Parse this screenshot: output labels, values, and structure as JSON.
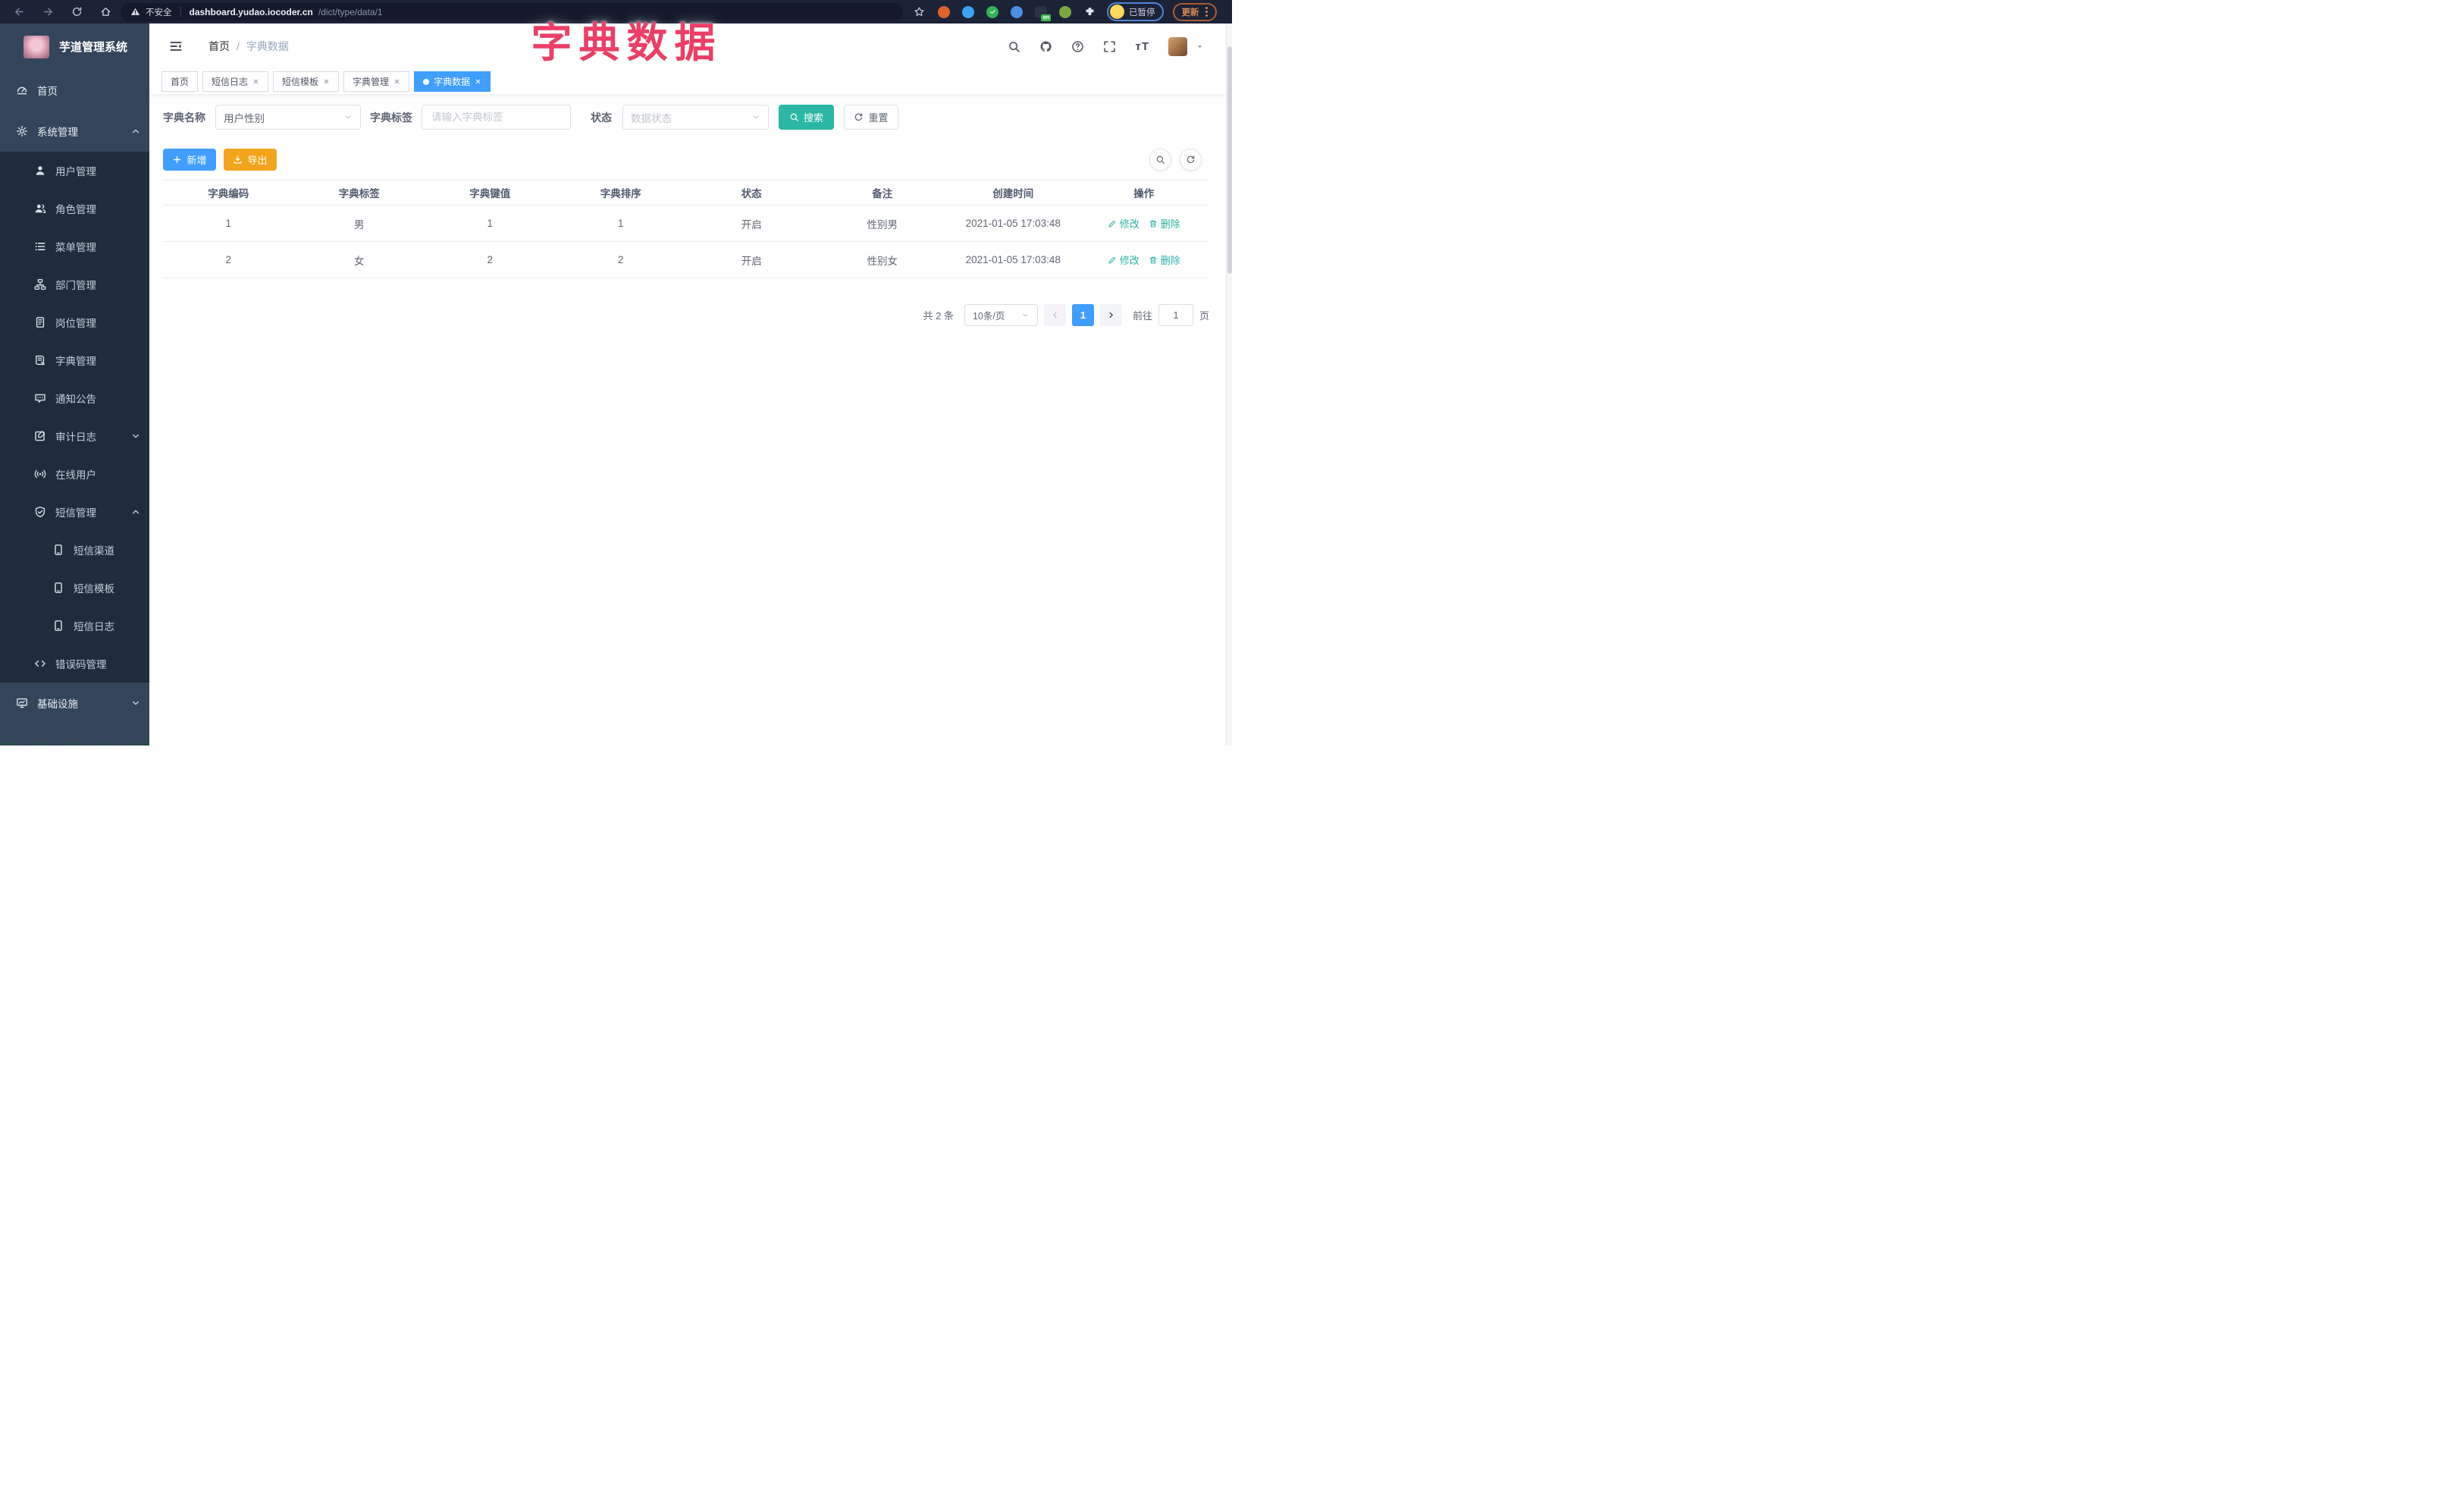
{
  "overlay_title": "字典数据",
  "colors": {
    "primary_blue": "#409eff",
    "search_teal": "#2bb7a5",
    "export_orange": "#f2a41c",
    "overlay_pink": "#ec3e66",
    "sidebar_dark": "#202c3c",
    "sidebar_light": "#34455b",
    "browser_bar": "#1d2337"
  },
  "browser": {
    "security_warning": "不安全",
    "url_host": "dashboard.yudao.iocoder.cn",
    "url_path": "/dict/type/data/1",
    "profile_status": "已暂停",
    "update_label": "更新",
    "extensions": [
      {
        "id": "orange-circle",
        "color": "#e2622b",
        "style": "circle"
      },
      {
        "id": "blue-drop",
        "color": "#3ba3f5",
        "style": "circle"
      },
      {
        "id": "green-check",
        "color": "#2fb457",
        "style": "check"
      },
      {
        "id": "blue-bars",
        "color": "#4b8fe2",
        "style": "circle"
      },
      {
        "id": "dark-on",
        "color": "#2b3242",
        "style": "square",
        "badge": "on",
        "badge_color": "#3dbb4a"
      },
      {
        "id": "green-leaf",
        "color": "#7aa83d",
        "style": "circle"
      },
      {
        "id": "puzzle",
        "color": "#dfe3ee",
        "style": "puzzle"
      }
    ]
  },
  "sidebar": {
    "logo_title": "芋道管理系统",
    "items": [
      {
        "id": "home",
        "label": "首页",
        "icon": "dashboard-icon",
        "level": 1,
        "section": "top"
      },
      {
        "id": "system-management",
        "label": "系统管理",
        "icon": "gear-icon",
        "level": 1,
        "section": "top",
        "chevron": "up"
      },
      {
        "id": "user-management",
        "label": "用户管理",
        "icon": "user-icon",
        "level": 2
      },
      {
        "id": "role-management",
        "label": "角色管理",
        "icon": "users-icon",
        "level": 2
      },
      {
        "id": "menu-management",
        "label": "菜单管理",
        "icon": "menu-list-icon",
        "level": 2
      },
      {
        "id": "dept-management",
        "label": "部门管理",
        "icon": "org-tree-icon",
        "level": 2
      },
      {
        "id": "post-management",
        "label": "岗位管理",
        "icon": "badge-icon",
        "level": 2
      },
      {
        "id": "dict-management",
        "label": "字典管理",
        "icon": "dictionary-icon",
        "level": 2
      },
      {
        "id": "notice-announcement",
        "label": "通知公告",
        "icon": "announcement-icon",
        "level": 2
      },
      {
        "id": "audit-log",
        "label": "审计日志",
        "icon": "audit-log-icon",
        "level": 2,
        "chevron": "down"
      },
      {
        "id": "online-users",
        "label": "在线用户",
        "icon": "online-users-icon",
        "level": 2
      },
      {
        "id": "sms-management",
        "label": "短信管理",
        "icon": "shield-check-icon",
        "level": 2,
        "chevron": "up"
      },
      {
        "id": "sms-channel",
        "label": "短信渠道",
        "icon": "phone-icon",
        "level": 3
      },
      {
        "id": "sms-template",
        "label": "短信模板",
        "icon": "phone-icon",
        "level": 3
      },
      {
        "id": "sms-log",
        "label": "短信日志",
        "icon": "phone-icon",
        "level": 3
      },
      {
        "id": "error-code-management",
        "label": "错误码管理",
        "icon": "code-icon",
        "level": 2
      },
      {
        "id": "infrastructure",
        "label": "基础设施",
        "icon": "monitor-icon",
        "level": 1,
        "section": "bottom",
        "chevron": "down"
      }
    ]
  },
  "header": {
    "breadcrumb_home": "首页",
    "breadcrumb_separator": "/",
    "breadcrumb_current": "字典数据",
    "font_size_icon_text": "тT",
    "icons": [
      "search-icon",
      "github-icon",
      "help-icon",
      "fullscreen-icon",
      "font-size-icon",
      "avatar",
      "caret-down-icon"
    ]
  },
  "tabs": [
    {
      "id": "home",
      "label": "首页",
      "closable": false,
      "active": false
    },
    {
      "id": "sms-log",
      "label": "短信日志",
      "closable": true,
      "active": false
    },
    {
      "id": "sms-template",
      "label": "短信模板",
      "closable": true,
      "active": false
    },
    {
      "id": "dict-management",
      "label": "字典管理",
      "closable": true,
      "active": false
    },
    {
      "id": "dict-data",
      "label": "字典数据",
      "closable": true,
      "active": true
    }
  ],
  "filters": {
    "dict_name_label": "字典名称",
    "dict_name_value": "用户性别",
    "dict_label_label": "字典标签",
    "dict_label_placeholder": "请输入字典标签",
    "status_label": "状态",
    "status_placeholder": "数据状态",
    "search_label": "搜索",
    "reset_label": "重置"
  },
  "toolbar": {
    "add_label": "新增",
    "export_label": "导出"
  },
  "table": {
    "headers": [
      "字典编码",
      "字典标签",
      "字典键值",
      "字典排序",
      "状态",
      "备注",
      "创建时间",
      "操作"
    ],
    "header_keys": [
      "dict-code",
      "dict-label",
      "dict-value",
      "dict-sort",
      "status",
      "remark",
      "created-time",
      "actions"
    ],
    "rows": [
      [
        "1",
        "男",
        "1",
        "1",
        "开启",
        "性别男",
        "2021-01-05 17:03:48"
      ],
      [
        "2",
        "女",
        "2",
        "2",
        "开启",
        "性别女",
        "2021-01-05 17:03:48"
      ]
    ],
    "actions": [
      {
        "id": "edit",
        "label": "修改",
        "icon": "edit-icon"
      },
      {
        "id": "delete",
        "label": "删除",
        "icon": "trash-icon"
      }
    ]
  },
  "pagination": {
    "total_text": "共 2 条",
    "page_size_value": "10条/页",
    "current_page": "1",
    "goto_label": "前往",
    "goto_value": "1",
    "page_unit_label": "页"
  }
}
